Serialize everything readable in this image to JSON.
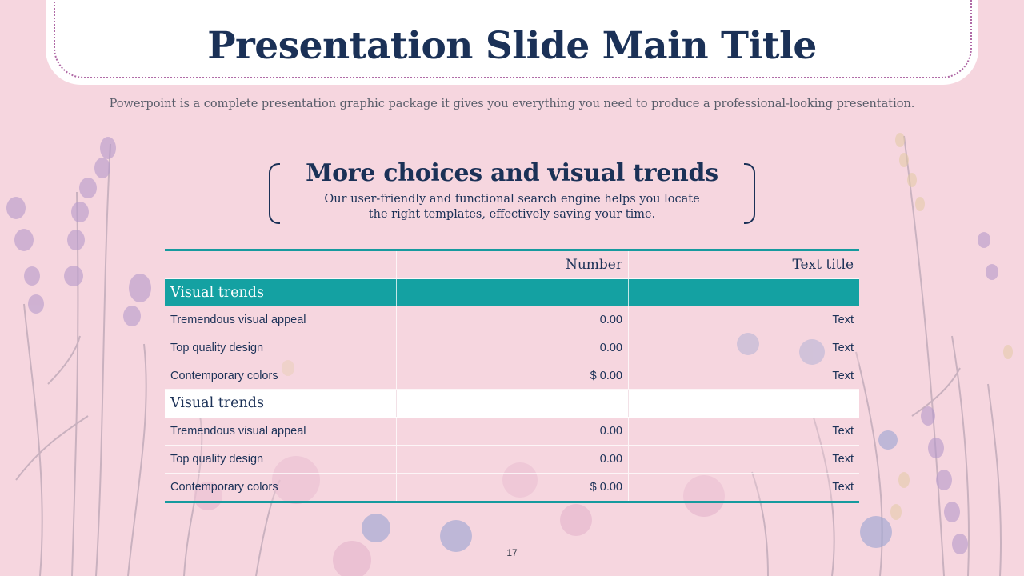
{
  "title": "Presentation Slide Main Title",
  "subtitle": "Powerpoint is a complete presentation graphic package it gives you everything you need to produce a professional-looking presentation.",
  "section": {
    "heading": "More choices and visual trends",
    "description": "Our user-friendly and functional search engine helps you locate the right templates, effectively saving your time."
  },
  "table": {
    "headers": [
      "",
      "Number",
      "Text title"
    ],
    "groups": [
      {
        "label": "Visual trends",
        "rows": [
          [
            "Tremendous visual appeal",
            "0.00",
            "Text"
          ],
          [
            "Top quality design",
            "0.00",
            "Text"
          ],
          [
            "Contemporary colors",
            "$ 0.00",
            "Text"
          ]
        ]
      },
      {
        "label": "Visual trends",
        "rows": [
          [
            "Tremendous visual appeal",
            "0.00",
            "Text"
          ],
          [
            "Top quality design",
            "0.00",
            "Text"
          ],
          [
            "Contemporary colors",
            "$ 0.00",
            "Text"
          ]
        ]
      }
    ]
  },
  "page_number": "17",
  "colors": {
    "background": "#f6d6df",
    "navy": "#1b3157",
    "teal": "#14a1a2",
    "dotted_border": "#b06aa6"
  }
}
